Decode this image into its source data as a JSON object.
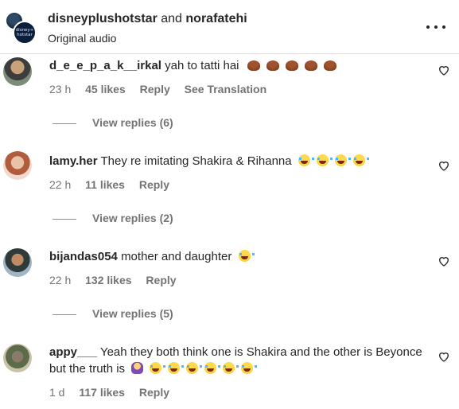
{
  "header": {
    "account1": "disneyplushotstar",
    "connector": " and ",
    "account2": "norafatehi",
    "subtitle": "Original audio",
    "avatar_logo_text": "disney+ hotstar"
  },
  "comments": [
    {
      "user": "d_e_e_p_a_k__irkal",
      "text": "yah to tatti hai",
      "emoji": [
        "poop-emoji",
        "poop-emoji",
        "poop-emoji",
        "poop-emoji",
        "poop-emoji"
      ],
      "time": "23 h",
      "likes": "45 likes",
      "reply": "Reply",
      "translate": "See Translation",
      "view_replies": "View replies (6)"
    },
    {
      "user": "lamy.her",
      "text": "They re imitating Shakira & Rihanna",
      "emoji": [
        "laughing-emoji",
        "laughing-emoji",
        "laughing-emoji",
        "laughing-emoji"
      ],
      "time": "22 h",
      "likes": "11 likes",
      "reply": "Reply",
      "view_replies": "View replies (2)"
    },
    {
      "user": "bijandas054",
      "text": "mother and daughter",
      "emoji": [
        "laughing-emoji"
      ],
      "time": "22 h",
      "likes": "132 likes",
      "reply": "Reply",
      "view_replies": "View replies (5)"
    },
    {
      "user": "appy___",
      "text": "Yeah they both think one is Shakira and the other is Beyonce but the truth is",
      "emoji": [
        "shrug-emoji",
        "laughing-emoji",
        "laughing-emoji",
        "laughing-emoji",
        "laughing-emoji",
        "laughing-emoji",
        "laughing-emoji"
      ],
      "time": "1 d",
      "likes": "117 likes",
      "reply": "Reply"
    }
  ],
  "icons": {
    "more": "more-options-icon",
    "like": "heart-icon"
  },
  "colors": {
    "text": "#262626",
    "muted": "#737373",
    "divider": "#dbdbdb"
  }
}
